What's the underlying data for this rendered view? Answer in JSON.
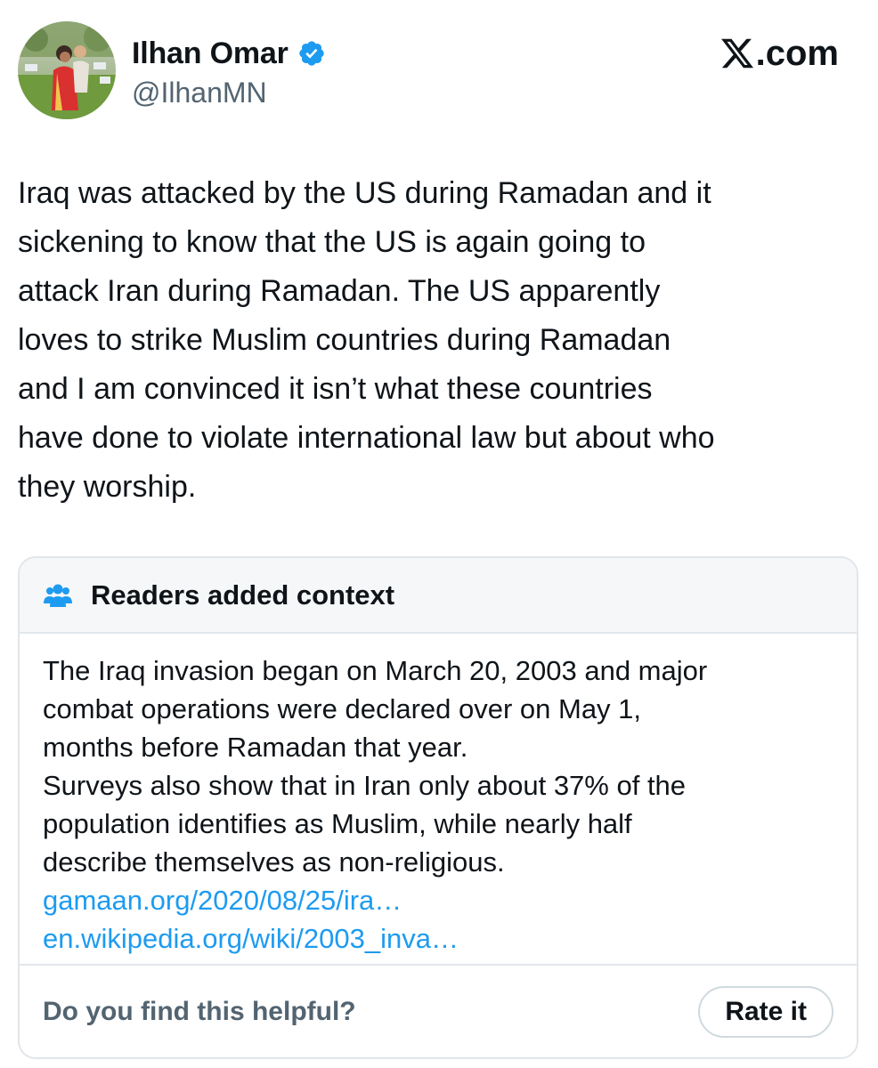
{
  "author": {
    "display_name": "Ilhan Omar",
    "handle": "@IlhanMN",
    "verified": true,
    "avatar_icon": "profile-photo"
  },
  "brand": {
    "logo_letter": "𝕏",
    "logo_text": ".com"
  },
  "tweet": {
    "text": "Iraq was attacked by the US during Ramadan and it\nsickening to know that the US is again going to\nattack Iran during Ramadan.  The US apparently\nloves to strike Muslim countries during Ramadan\nand I am convinced it isn’t what these countries\nhave done to violate international law but about who\nthey worship."
  },
  "note": {
    "title": "Readers added context",
    "icon": "people-icon",
    "paragraph1": "The Iraq invasion began on March 20, 2003 and major\ncombat operations were declared over on May 1,\nmonths before Ramadan that year.",
    "paragraph2": "Surveys also show that in Iran only about 37% of the\npopulation identifies as Muslim, while nearly half\ndescribe themselves as non-religious.",
    "links": [
      "gamaan.org/2020/08/25/ira…",
      "en.wikipedia.org/wiki/2003_inva…"
    ],
    "helpful_prompt": "Do you find this helpful?",
    "rate_label": "Rate it"
  },
  "colors": {
    "text": "#0f1419",
    "secondary": "#536471",
    "link": "#1d9bf0",
    "verified": "#1d9bf0",
    "card_border": "#e2e6ea",
    "card_header_bg": "#f6f7f9"
  }
}
